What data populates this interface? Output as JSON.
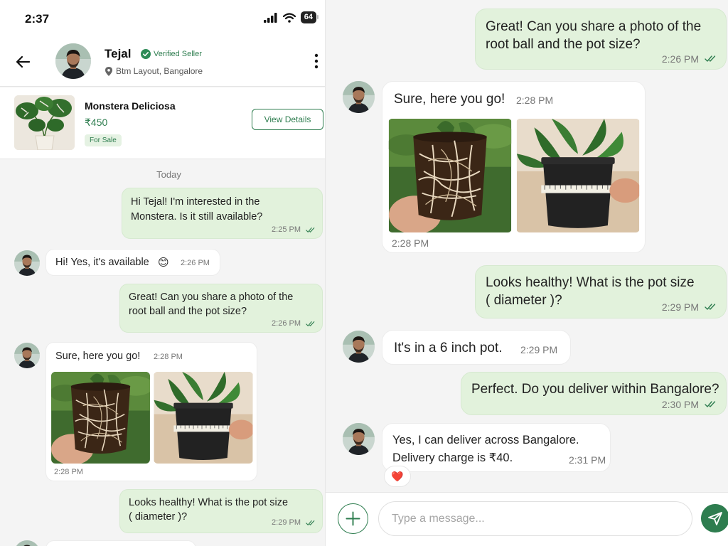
{
  "status_bar": {
    "time": "2:37",
    "battery": "64"
  },
  "header": {
    "name": "Tejal",
    "verified_label": "Verified Seller",
    "location": "Btm Layout, Bangalore"
  },
  "product": {
    "name": "Monstera Deliciosa",
    "price": "₹450",
    "status": "For Sale",
    "view_label": "View Details"
  },
  "date_divider": "Today",
  "messages": {
    "m1": {
      "line1": "Hi Tejal! I'm interested in the",
      "line2": "Monstera. Is it still available?",
      "time": "2:25 PM"
    },
    "m2": {
      "text": "Hi! Yes, it's available",
      "emoji": "😊",
      "time": "2:26 PM"
    },
    "m3": {
      "line1": "Great! Can you share a photo of the",
      "line2": "root ball and the pot size?",
      "time": "2:26 PM"
    },
    "m4": {
      "text": "Sure, here you go!",
      "time": "2:28 PM",
      "photo_time": "2:28 PM"
    },
    "m5": {
      "line1": "Looks healthy! What is the pot size",
      "line2": "( diameter )?",
      "time": "2:29 PM"
    },
    "m6": {
      "text": "It's in a 6 inch pot.",
      "time": "2:29 PM"
    },
    "m7": {
      "text": "Perfect. Do you deliver within Bangalore?",
      "time": "2:30 PM"
    },
    "m8": {
      "line1": "Yes, I can deliver across Bangalore.",
      "line2": "Delivery charge is ₹40.",
      "time": "2:31 PM",
      "reaction": "❤️"
    }
  },
  "composer": {
    "placeholder": "Type a message..."
  },
  "colors": {
    "accent": "#2e7d4f",
    "outgoing_bubble": "#e2f2dc",
    "incoming_bubble": "#ffffff",
    "background": "#f4f4f4"
  }
}
